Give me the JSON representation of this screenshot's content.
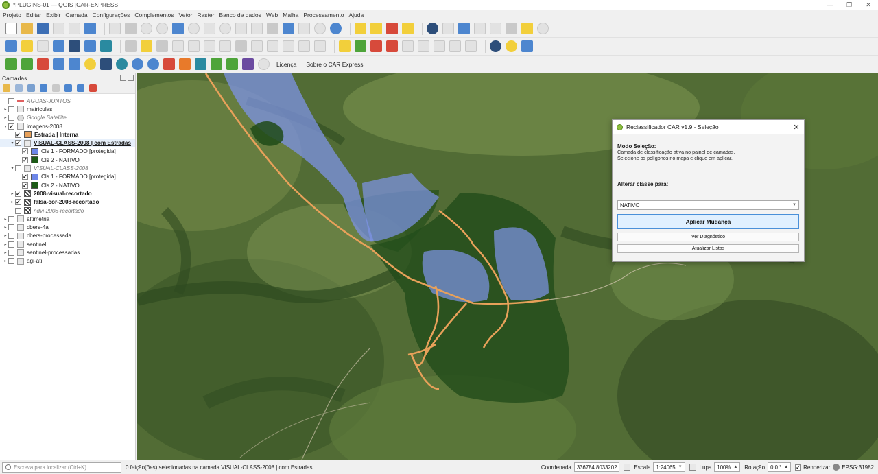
{
  "window": {
    "title": "*PLUGINS-01 — QGIS [CAR-EXPRESS]",
    "controls": [
      "—",
      "❐",
      "✕"
    ]
  },
  "menubar": [
    "Projeto",
    "Editar",
    "Exibir",
    "Camada",
    "Configurações",
    "Complementos",
    "Vetor",
    "Raster",
    "Banco de dados",
    "Web",
    "Malha",
    "Processamento",
    "Ajuda"
  ],
  "plugin_toolbar": {
    "licenca": "Licença",
    "sobre": "Sobre o CAR Express"
  },
  "layers_panel": {
    "title": "Camadas",
    "layers": [
      {
        "label": "AGUAS-JUNTOS",
        "style": "italic",
        "checked": false,
        "icon": "line",
        "indent": 0,
        "arrow": ""
      },
      {
        "label": "matriculas",
        "style": "normal",
        "checked": false,
        "icon": "group",
        "indent": 0,
        "arrow": "▸"
      },
      {
        "label": "Google Satellite",
        "style": "italic",
        "checked": false,
        "icon": "globe",
        "indent": 0,
        "arrow": "▸"
      },
      {
        "label": "imagens-2008",
        "style": "normal",
        "checked": true,
        "icon": "group",
        "indent": 0,
        "arrow": "▾"
      },
      {
        "label": "Estrada | Interna",
        "style": "bold",
        "checked": true,
        "icon": "swatch",
        "color": "#e8a15a",
        "indent": 1,
        "arrow": ""
      },
      {
        "label": "VISUAL-CLASS-2008 | com Estradas",
        "style": "ubold",
        "checked": true,
        "icon": "group",
        "indent": 1,
        "arrow": "▾",
        "selected": true
      },
      {
        "label": "Cls 1 - FORMADO [protegida]",
        "style": "normal",
        "checked": true,
        "icon": "swatch",
        "color": "#6d86e8",
        "indent": 2,
        "arrow": ""
      },
      {
        "label": "Cls 2 - NATIVO",
        "style": "normal",
        "checked": true,
        "icon": "swatch",
        "color": "#1c5a16",
        "indent": 2,
        "arrow": ""
      },
      {
        "label": "VISUAL-CLASS-2008",
        "style": "italic",
        "checked": false,
        "icon": "group",
        "indent": 1,
        "arrow": "▾"
      },
      {
        "label": "Cls 1 - FORMADO [protegida]",
        "style": "normal",
        "checked": true,
        "icon": "swatch",
        "color": "#6d86e8",
        "indent": 2,
        "arrow": ""
      },
      {
        "label": "Cls 2 - NATIVO",
        "style": "normal",
        "checked": true,
        "icon": "swatch",
        "color": "#1c5a16",
        "indent": 2,
        "arrow": ""
      },
      {
        "label": "2008-visual-recortado",
        "style": "bold",
        "checked": true,
        "icon": "raster",
        "indent": 1,
        "arrow": "▸"
      },
      {
        "label": "falsa-cor-2008-recortado",
        "style": "bold",
        "checked": true,
        "icon": "raster",
        "indent": 1,
        "arrow": "▸"
      },
      {
        "label": "ndvi-2008-recortado",
        "style": "italic",
        "checked": false,
        "icon": "raster",
        "indent": 1,
        "arrow": ""
      },
      {
        "label": "altimetria",
        "style": "normal",
        "checked": false,
        "icon": "group",
        "indent": 0,
        "arrow": "▸"
      },
      {
        "label": "cbers-4a",
        "style": "normal",
        "checked": false,
        "icon": "group",
        "indent": 0,
        "arrow": "▸"
      },
      {
        "label": "cbers-processada",
        "style": "normal",
        "checked": false,
        "icon": "group",
        "indent": 0,
        "arrow": "▸"
      },
      {
        "label": "sentinel",
        "style": "normal",
        "checked": false,
        "icon": "group",
        "indent": 0,
        "arrow": "▸"
      },
      {
        "label": "sentinel-processadas",
        "style": "normal",
        "checked": false,
        "icon": "group",
        "indent": 0,
        "arrow": "▸"
      },
      {
        "label": "agi-ati",
        "style": "normal",
        "checked": false,
        "icon": "group",
        "indent": 0,
        "arrow": "▸"
      }
    ]
  },
  "dialog": {
    "title": "Reclassificador CAR v1.9 - Seleção",
    "close": "✕",
    "mode_heading": "Modo Seleção:",
    "mode_line1": "Camada de classificação ativa no painel de camadas.",
    "mode_line2": "Selecione os polígonos no mapa e clique em aplicar.",
    "change_heading": "Alterar classe para:",
    "selected_class": "NATIVO",
    "apply_button": "Aplicar Mudança",
    "diagnostic_button": "Ver Diagnóstico",
    "refresh_button": "Atualizar Listas"
  },
  "statusbar": {
    "locator_placeholder": "Escreva para localizar (Ctrl+K)",
    "message": "0 feição(ões) selecionadas na camada VISUAL-CLASS-2008 | com Estradas.",
    "coord_label": "Coordenada",
    "coord_value": "336784 8033202",
    "scale_label": "Escala",
    "scale_value": "1:24065",
    "magnifier_label": "Lupa",
    "magnifier_value": "100%",
    "rotation_label": "Rotação",
    "rotation_value": "0,0 °",
    "render_label": "Renderizar",
    "crs": "EPSG:31982"
  },
  "colors": {
    "formado": "#6d86e8",
    "nativo": "#1c5a16",
    "estrada": "#e8a15a",
    "accent": "#4a90d9"
  }
}
